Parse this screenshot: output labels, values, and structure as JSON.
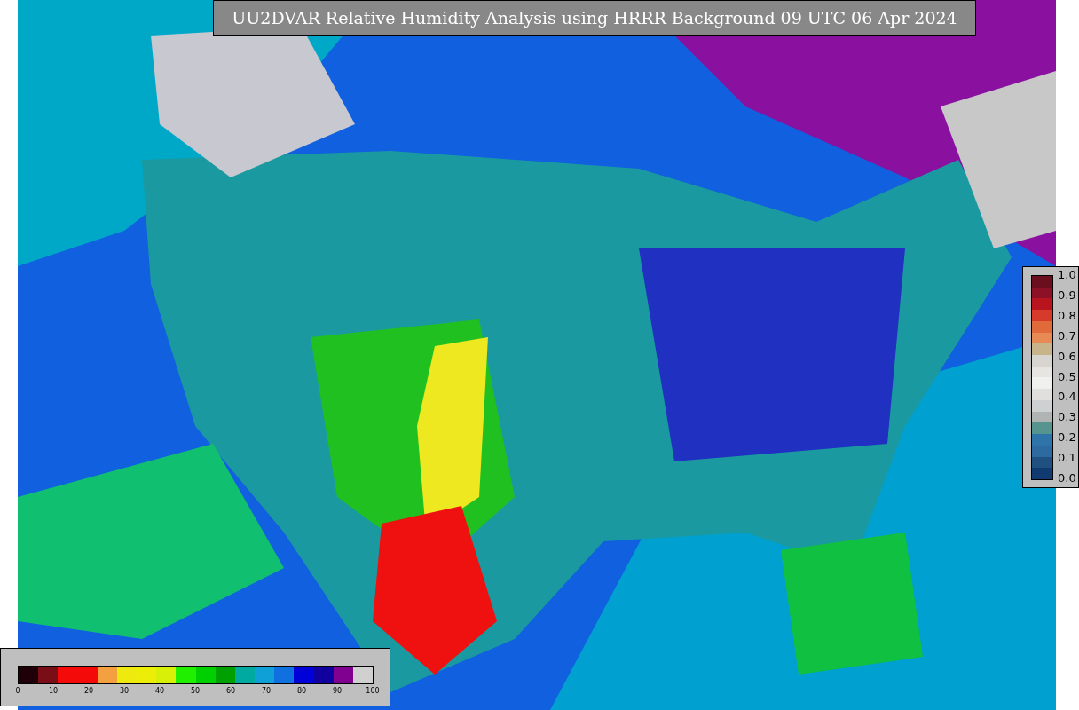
{
  "title": "UU2DVAR Relative Humidity Analysis using HRRR Background 09 UTC 06 Apr 2024",
  "right_colorbar": {
    "ticks": [
      "1.0",
      "0.9",
      "0.8",
      "0.7",
      "0.6",
      "0.5",
      "0.4",
      "0.3",
      "0.2",
      "0.1",
      "0.0"
    ],
    "segments": [
      {
        "color": "#6b0f1f"
      },
      {
        "color": "#8c1026"
      },
      {
        "color": "#b8141e"
      },
      {
        "color": "#d63a2a"
      },
      {
        "color": "#e06a3a"
      },
      {
        "color": "#e88a55"
      },
      {
        "color": "#c8b48a"
      },
      {
        "color": "#d8d4d0"
      },
      {
        "color": "#e6e5e2"
      },
      {
        "color": "#f0f0ef"
      },
      {
        "color": "#e0dfdd"
      },
      {
        "color": "#cfd0d2"
      },
      {
        "color": "#b0b4b3"
      },
      {
        "color": "#55948f"
      },
      {
        "color": "#2f74a8"
      },
      {
        "color": "#2d6aa0"
      },
      {
        "color": "#1f5080"
      },
      {
        "color": "#103a70"
      }
    ]
  },
  "bottom_colorbar": {
    "ticks": [
      "0",
      "10",
      "20",
      "30",
      "40",
      "50",
      "60",
      "70",
      "80",
      "90",
      "100"
    ],
    "segments": [
      {
        "color": "#200008"
      },
      {
        "color": "#7a0e16"
      },
      {
        "color": "#f50a0a"
      },
      {
        "color": "#f50a0a"
      },
      {
        "color": "#f3a040"
      },
      {
        "color": "#eeea10"
      },
      {
        "color": "#ecee08"
      },
      {
        "color": "#d8f008"
      },
      {
        "color": "#20f000"
      },
      {
        "color": "#00d000"
      },
      {
        "color": "#00a000"
      },
      {
        "color": "#00aaa0"
      },
      {
        "color": "#10a0d8"
      },
      {
        "color": "#1070e0"
      },
      {
        "color": "#0000d8"
      },
      {
        "color": "#1000a0"
      },
      {
        "color": "#800090"
      },
      {
        "color": "#d0d0d0"
      }
    ]
  }
}
